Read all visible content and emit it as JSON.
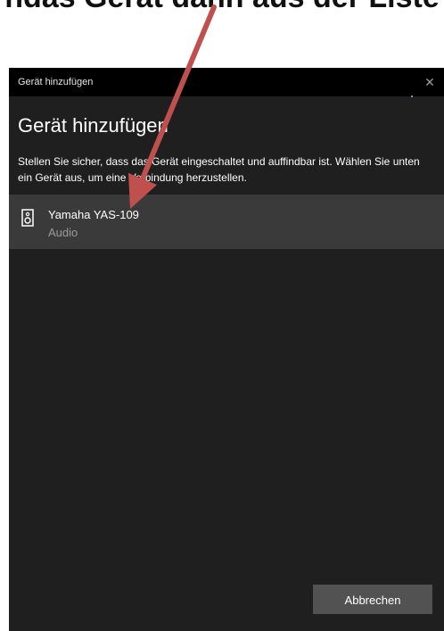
{
  "top_caption": "ndas Gerät dann aus der Liste",
  "window": {
    "title": "Gerät hinzufügen",
    "close_glyph": "✕"
  },
  "dialog": {
    "heading": "Gerät hinzufügen",
    "instructions": "Stellen Sie sicher, dass das Gerät eingeschaltet und auffindbar ist. Wählen Sie unten ein Gerät aus, um eine Verbindung herzustellen."
  },
  "devices": [
    {
      "name": "Yamaha YAS-109",
      "type": "Audio",
      "icon": "speaker-icon"
    }
  ],
  "footer": {
    "cancel_label": "Abbrechen"
  },
  "annotation": {
    "arrow_color": "#c0504d"
  },
  "colors": {
    "window_bg": "#1f1f1f",
    "titlebar_bg": "#000000",
    "selected_row_bg": "#3a3a3a",
    "button_bg": "#525252"
  }
}
